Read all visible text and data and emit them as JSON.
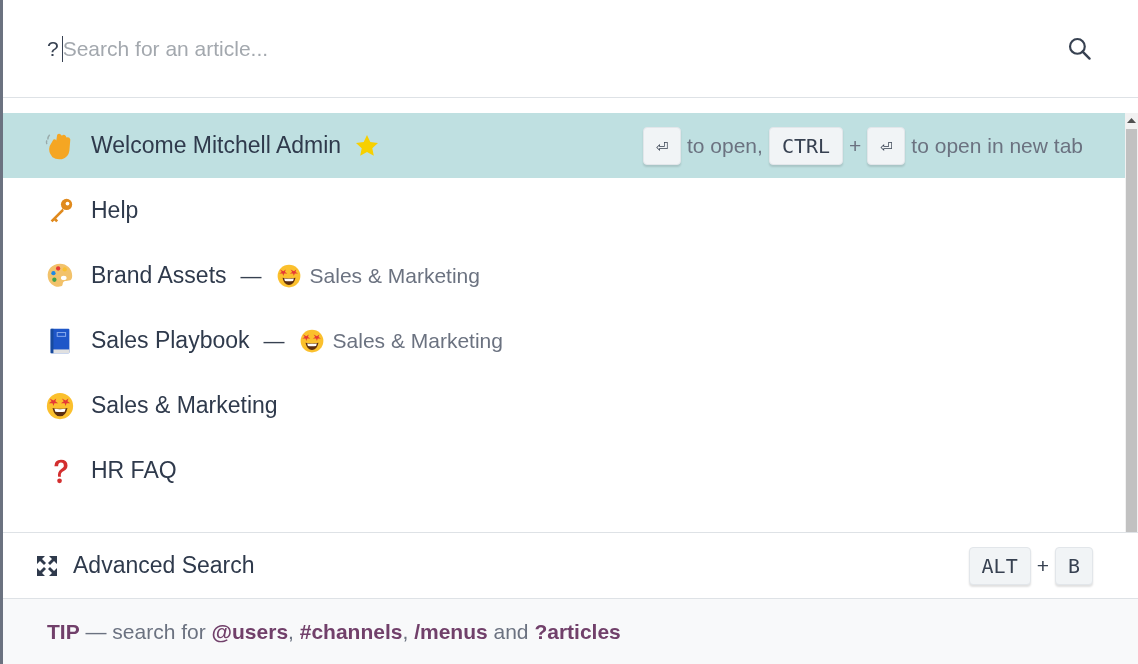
{
  "search": {
    "prefix": "?",
    "placeholder": "Search for an article..."
  },
  "results": [
    {
      "title": "Welcome Mitchell Admin",
      "favorite": true,
      "selected": true
    },
    {
      "title": "Help",
      "favorite": false,
      "selected": false
    },
    {
      "title": "Brand Assets",
      "favorite": false,
      "selected": false,
      "separator": "—",
      "parent": "Sales & Marketing"
    },
    {
      "title": "Sales Playbook",
      "favorite": false,
      "selected": false,
      "separator": "—",
      "parent": "Sales & Marketing"
    },
    {
      "title": "Sales & Marketing",
      "favorite": false,
      "selected": false
    },
    {
      "title": "HR FAQ",
      "favorite": false,
      "selected": false
    }
  ],
  "hint": [
    {
      "kind": "key",
      "text": "⏎"
    },
    {
      "kind": "text",
      "text": "to open,"
    },
    {
      "kind": "key",
      "text": "CTRL"
    },
    {
      "kind": "text",
      "text": "+"
    },
    {
      "kind": "key",
      "text": "⏎"
    },
    {
      "kind": "text",
      "text": "to open in new tab"
    }
  ],
  "advanced_search": {
    "label": "Advanced Search",
    "shortcut": [
      {
        "kind": "key",
        "text": "ALT"
      },
      {
        "kind": "text",
        "text": "+"
      },
      {
        "kind": "key",
        "text": "B"
      }
    ]
  },
  "tip": "**TIP** — search for **@users**, **#channels**, **/menus** and **?articles**"
}
